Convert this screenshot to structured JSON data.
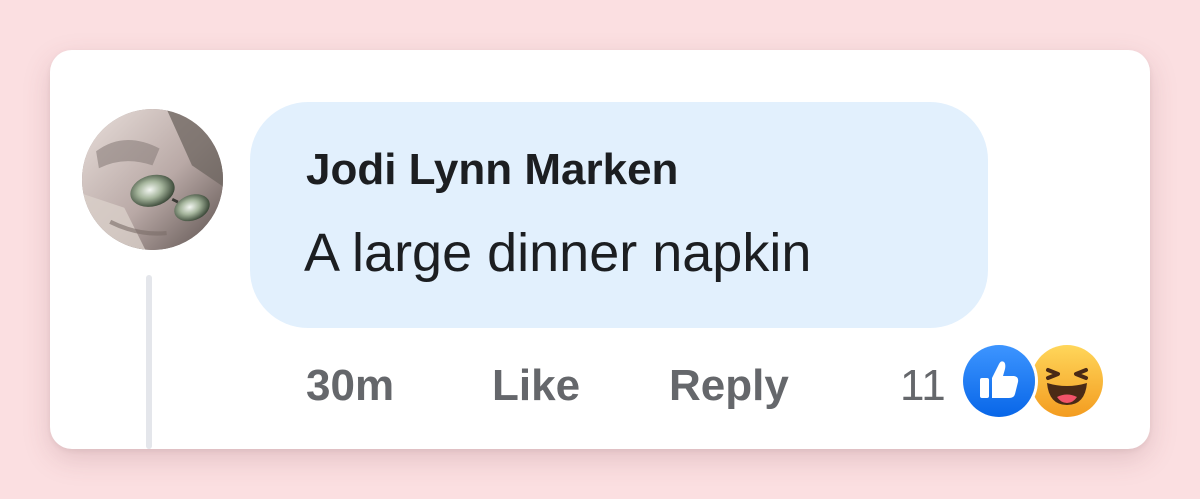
{
  "comment": {
    "author": "Jodi Lynn Marken",
    "text": "A large dinner napkin",
    "time": "30m",
    "like_label": "Like",
    "reply_label": "Reply",
    "reaction_count": "11",
    "reactions": [
      "like-icon",
      "haha-icon"
    ]
  },
  "colors": {
    "background": "#fbdfe1",
    "bubble": "#e2f0fd",
    "like_blue": "#1877f2",
    "haha_yellow": "#f7b125",
    "muted_text": "#65676b"
  }
}
